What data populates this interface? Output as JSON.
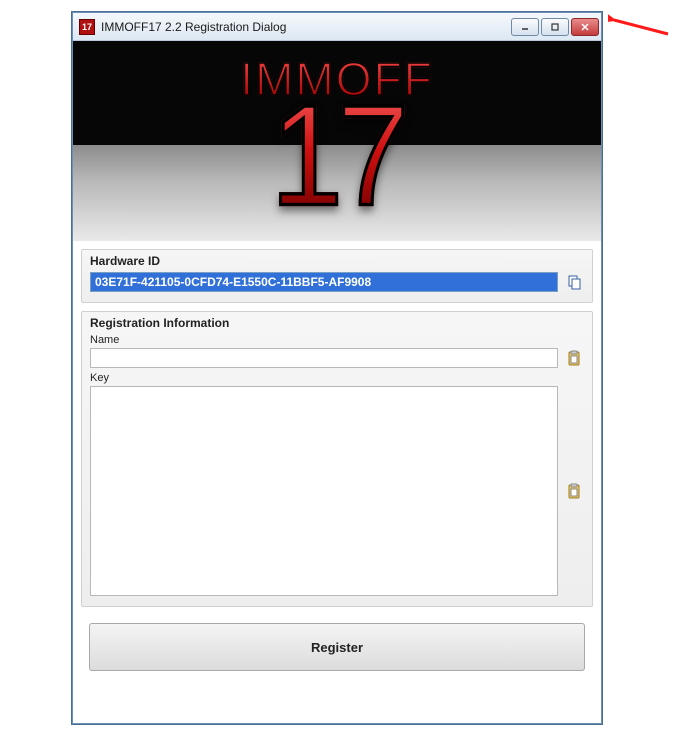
{
  "window": {
    "title": "IMMOFF17 2.2 Registration Dialog",
    "app_icon_text": "17"
  },
  "logo": {
    "line1": "IMMOFF",
    "line2": "17"
  },
  "hardware_id_group": {
    "title": "Hardware ID",
    "value": "03E71F-421105-0CFD74-E1550C-11BBF5-AF9908",
    "copy_icon": "copy-icon"
  },
  "registration_group": {
    "title": "Registration Information",
    "name_label": "Name",
    "name_value": "",
    "name_paste_icon": "paste-icon",
    "key_label": "Key",
    "key_value": "",
    "key_paste_icon": "paste-icon"
  },
  "register_button_label": "Register"
}
